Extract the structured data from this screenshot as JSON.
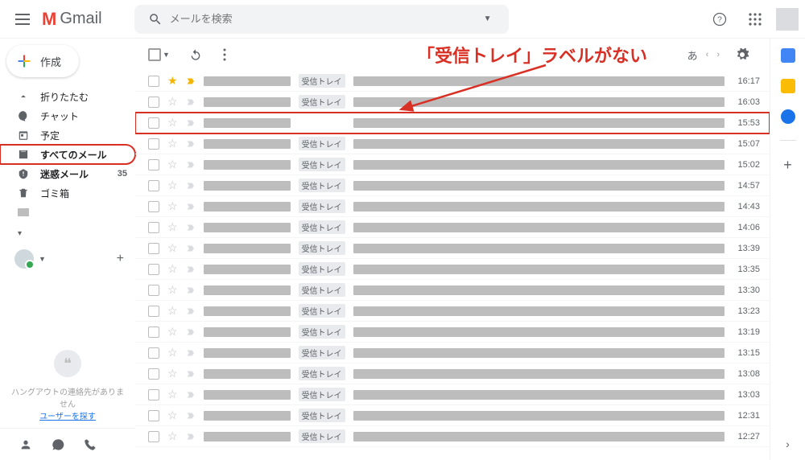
{
  "header": {
    "logo_text": "Gmail",
    "search_placeholder": "メールを検索"
  },
  "compose_label": "作成",
  "sidebar": {
    "items": [
      {
        "icon": "collapse",
        "label": "折りたたむ",
        "bold": false
      },
      {
        "icon": "chat",
        "label": "チャット",
        "bold": false
      },
      {
        "icon": "schedule",
        "label": "予定",
        "bold": false
      },
      {
        "icon": "allmail",
        "label": "すべてのメール",
        "bold": true,
        "outlined": true
      },
      {
        "icon": "spam",
        "label": "迷惑メール",
        "bold": true,
        "count": "35"
      },
      {
        "icon": "trash",
        "label": "ゴミ箱",
        "bold": false
      },
      {
        "icon": "label",
        "label": "",
        "bold": false
      }
    ],
    "hangouts_text": "ハングアウトの連絡先がありません",
    "hangouts_link": "ユーザーを探す"
  },
  "toolbar": {
    "input_mode": "あ"
  },
  "label_chip": "受信トレイ",
  "rows": [
    {
      "starred": true,
      "important": true,
      "showLabel": true,
      "time": "16:17"
    },
    {
      "starred": false,
      "important": false,
      "showLabel": true,
      "time": "16:03"
    },
    {
      "starred": false,
      "important": false,
      "showLabel": false,
      "time": "15:53",
      "highlighted": true
    },
    {
      "starred": false,
      "important": false,
      "showLabel": true,
      "time": "15:07"
    },
    {
      "starred": false,
      "important": false,
      "showLabel": true,
      "time": "15:02"
    },
    {
      "starred": false,
      "important": false,
      "showLabel": true,
      "time": "14:57"
    },
    {
      "starred": false,
      "important": false,
      "showLabel": true,
      "time": "14:43"
    },
    {
      "starred": false,
      "important": false,
      "showLabel": true,
      "time": "14:06"
    },
    {
      "starred": false,
      "important": false,
      "showLabel": true,
      "time": "13:39"
    },
    {
      "starred": false,
      "important": false,
      "showLabel": true,
      "time": "13:35"
    },
    {
      "starred": false,
      "important": false,
      "showLabel": true,
      "time": "13:30"
    },
    {
      "starred": false,
      "important": false,
      "showLabel": true,
      "time": "13:23"
    },
    {
      "starred": false,
      "important": false,
      "showLabel": true,
      "time": "13:19"
    },
    {
      "starred": false,
      "important": false,
      "showLabel": true,
      "time": "13:15"
    },
    {
      "starred": false,
      "important": false,
      "showLabel": true,
      "time": "13:08"
    },
    {
      "starred": false,
      "important": false,
      "showLabel": true,
      "time": "13:03"
    },
    {
      "starred": false,
      "important": false,
      "showLabel": true,
      "time": "12:31"
    },
    {
      "starred": false,
      "important": false,
      "showLabel": true,
      "time": "12:27"
    }
  ],
  "annotation": "「受信トレイ」ラベルがない"
}
